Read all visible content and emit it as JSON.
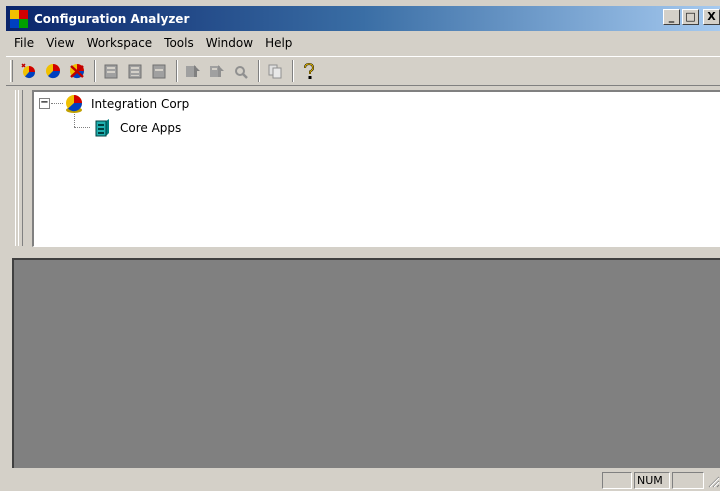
{
  "window": {
    "title": "Configuration Analyzer",
    "minimize_label": "_",
    "maximize_label": "□",
    "close_label": "X"
  },
  "menu": {
    "items": [
      {
        "label": "File"
      },
      {
        "label": "View"
      },
      {
        "label": "Workspace"
      },
      {
        "label": "Tools"
      },
      {
        "label": "Window"
      },
      {
        "label": "Help"
      }
    ]
  },
  "toolbar": {
    "buttons": [
      {
        "icon": "new-enterprise-icon"
      },
      {
        "icon": "open-enterprise-icon"
      },
      {
        "icon": "delete-enterprise-icon"
      },
      {
        "icon": "new-application-icon"
      },
      {
        "icon": "open-application-icon"
      },
      {
        "icon": "close-application-icon"
      },
      {
        "icon": "analyze-icon"
      },
      {
        "icon": "analyze-all-icon"
      },
      {
        "icon": "find-icon"
      },
      {
        "icon": "copy-icon"
      },
      {
        "icon": "help-icon"
      }
    ]
  },
  "tree": {
    "root": {
      "label": "Integration Corp",
      "icon": "enterprise-pie-icon",
      "expander": "−"
    },
    "child": {
      "label": "Core Apps",
      "icon": "server-icon"
    }
  },
  "statusbar": {
    "num_label": "NUM"
  },
  "colors": {
    "title_start": "#0a246a",
    "title_end": "#a6caf0",
    "face": "#d4d0c8",
    "workspace": "#808080"
  }
}
